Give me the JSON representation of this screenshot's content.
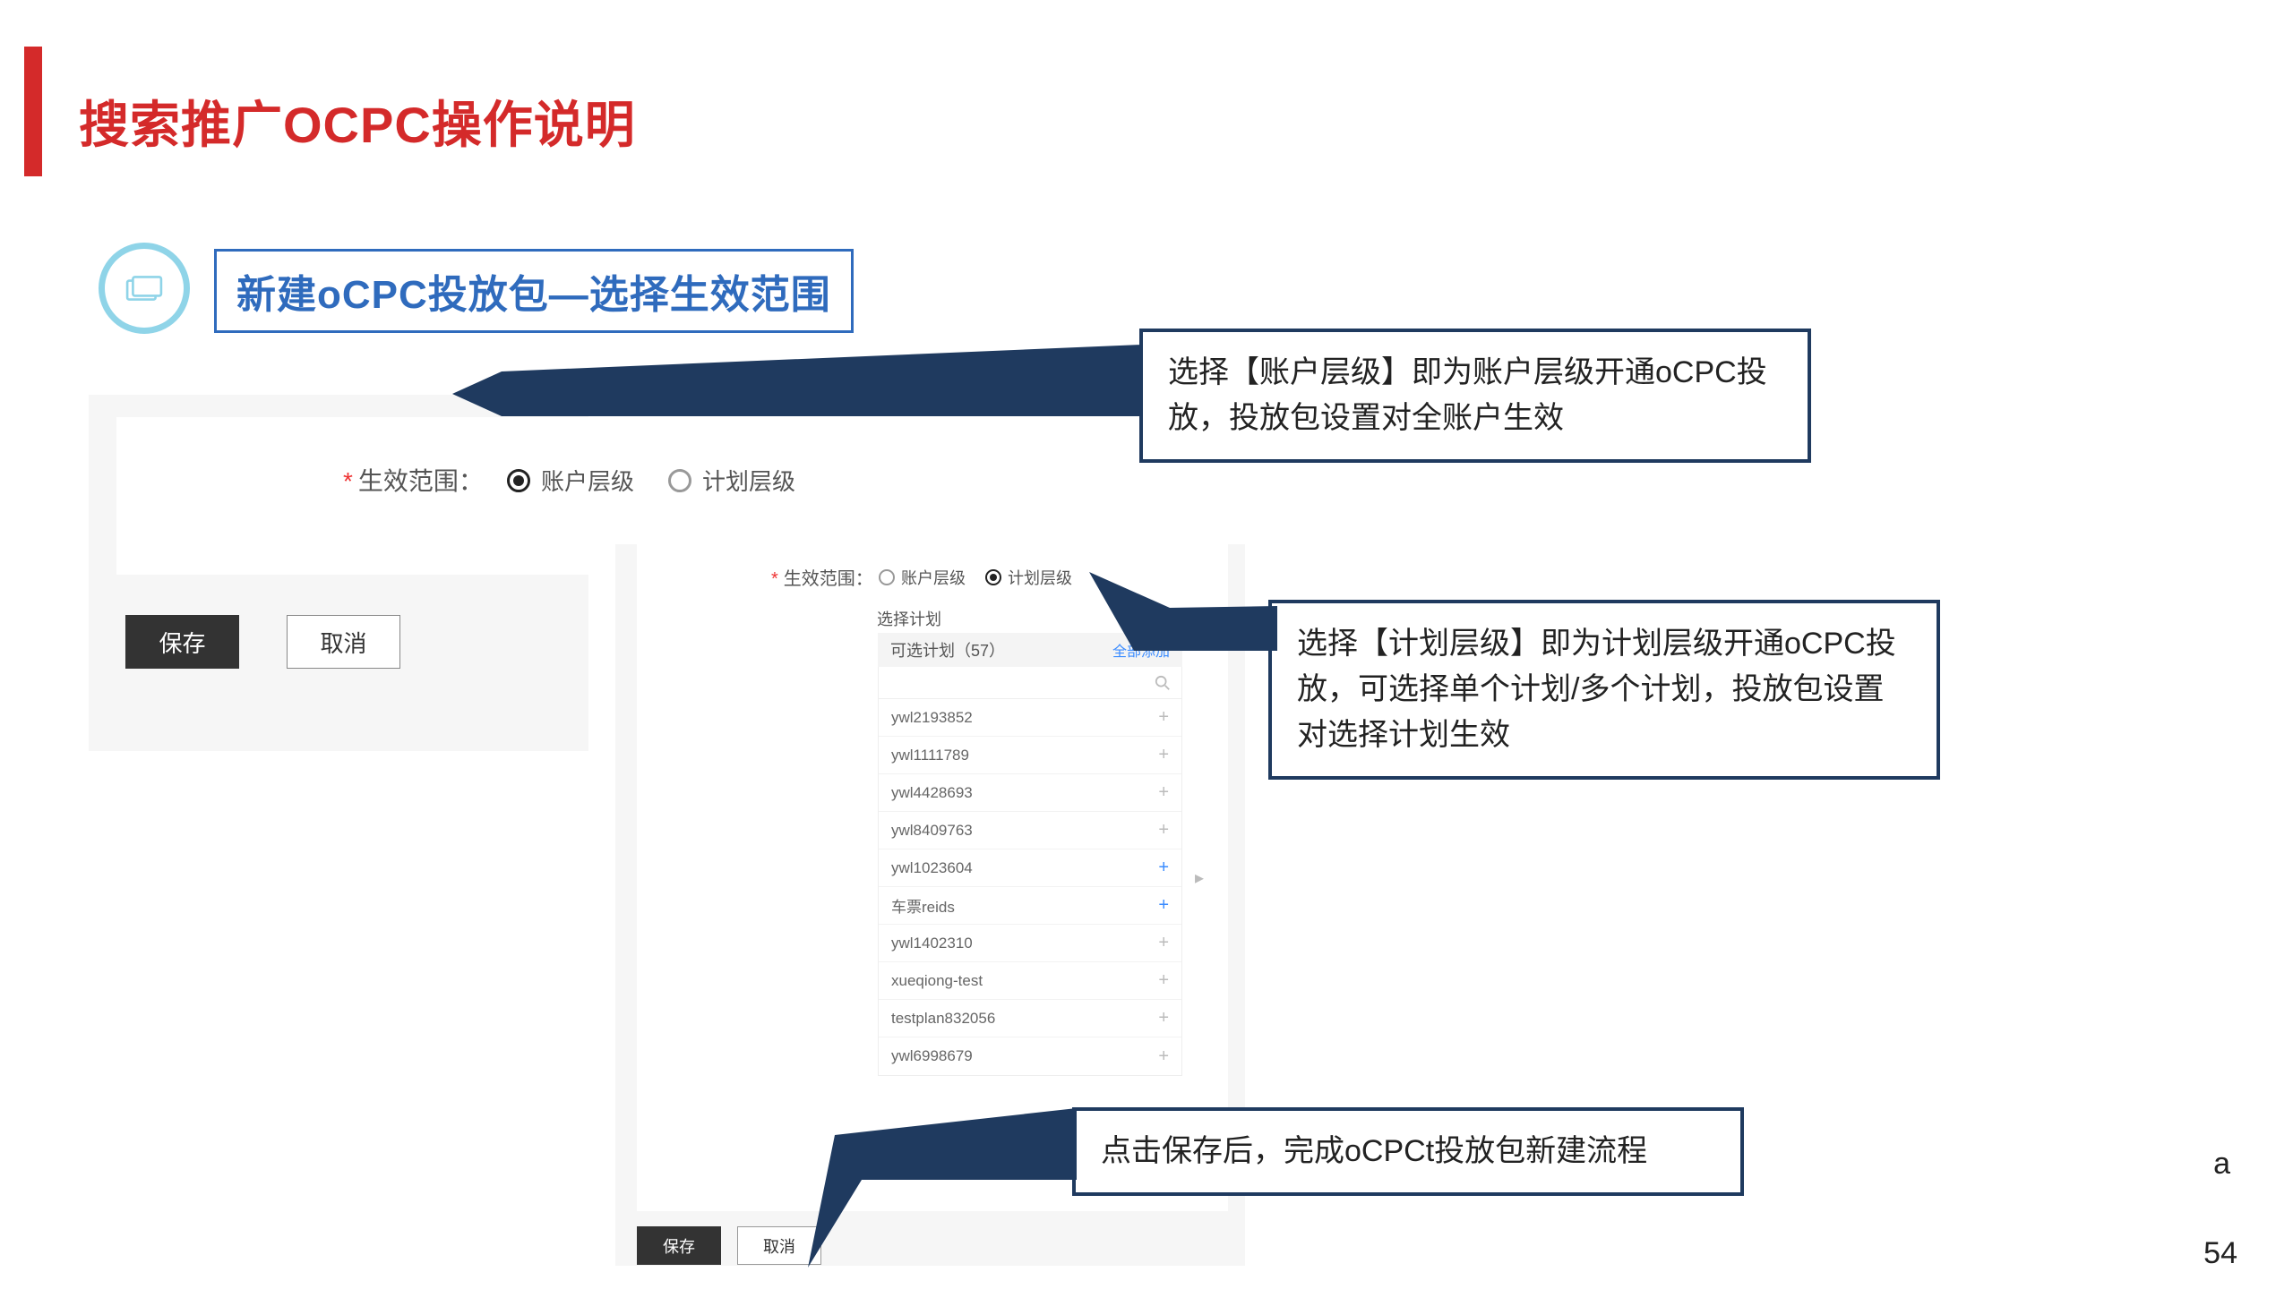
{
  "title": "搜索推广OCPC操作说明",
  "subtitle": "新建oCPC投放包—选择生效范围",
  "panel1": {
    "label": "生效范围：",
    "radio_account": "账户层级",
    "radio_plan": "计划层级",
    "save": "保存",
    "cancel": "取消"
  },
  "panel2": {
    "label": "生效范围：",
    "radio_account": "账户层级",
    "radio_plan": "计划层级",
    "select_plan": "选择计划",
    "available_plans": "可选计划（57）",
    "add_all": "全部添加",
    "save": "保存",
    "cancel": "取消",
    "plans": [
      {
        "name": "ywl2193852",
        "blue": false
      },
      {
        "name": "ywl1111789",
        "blue": false
      },
      {
        "name": "ywl4428693",
        "blue": false
      },
      {
        "name": "ywl8409763",
        "blue": false
      },
      {
        "name": "ywl1023604",
        "blue": true
      },
      {
        "name": "车票reids",
        "blue": true
      },
      {
        "name": "ywl1402310",
        "blue": false
      },
      {
        "name": "xueqiong-test",
        "blue": false
      },
      {
        "name": "testplan832056",
        "blue": false
      },
      {
        "name": "ywl6998679",
        "blue": false
      }
    ]
  },
  "callouts": {
    "c1": "选择【账户层级】即为账户层级开通oCPC投放，投放包设置对全账户生效",
    "c2": "选择【计划层级】即为计划层级开通oCPC投放，可选择单个计划/多个计划，投放包设置对选择计划生效",
    "c3": "点击保存后，完成oCPCt投放包新建流程"
  },
  "footer_a": "a",
  "page_num": "54"
}
